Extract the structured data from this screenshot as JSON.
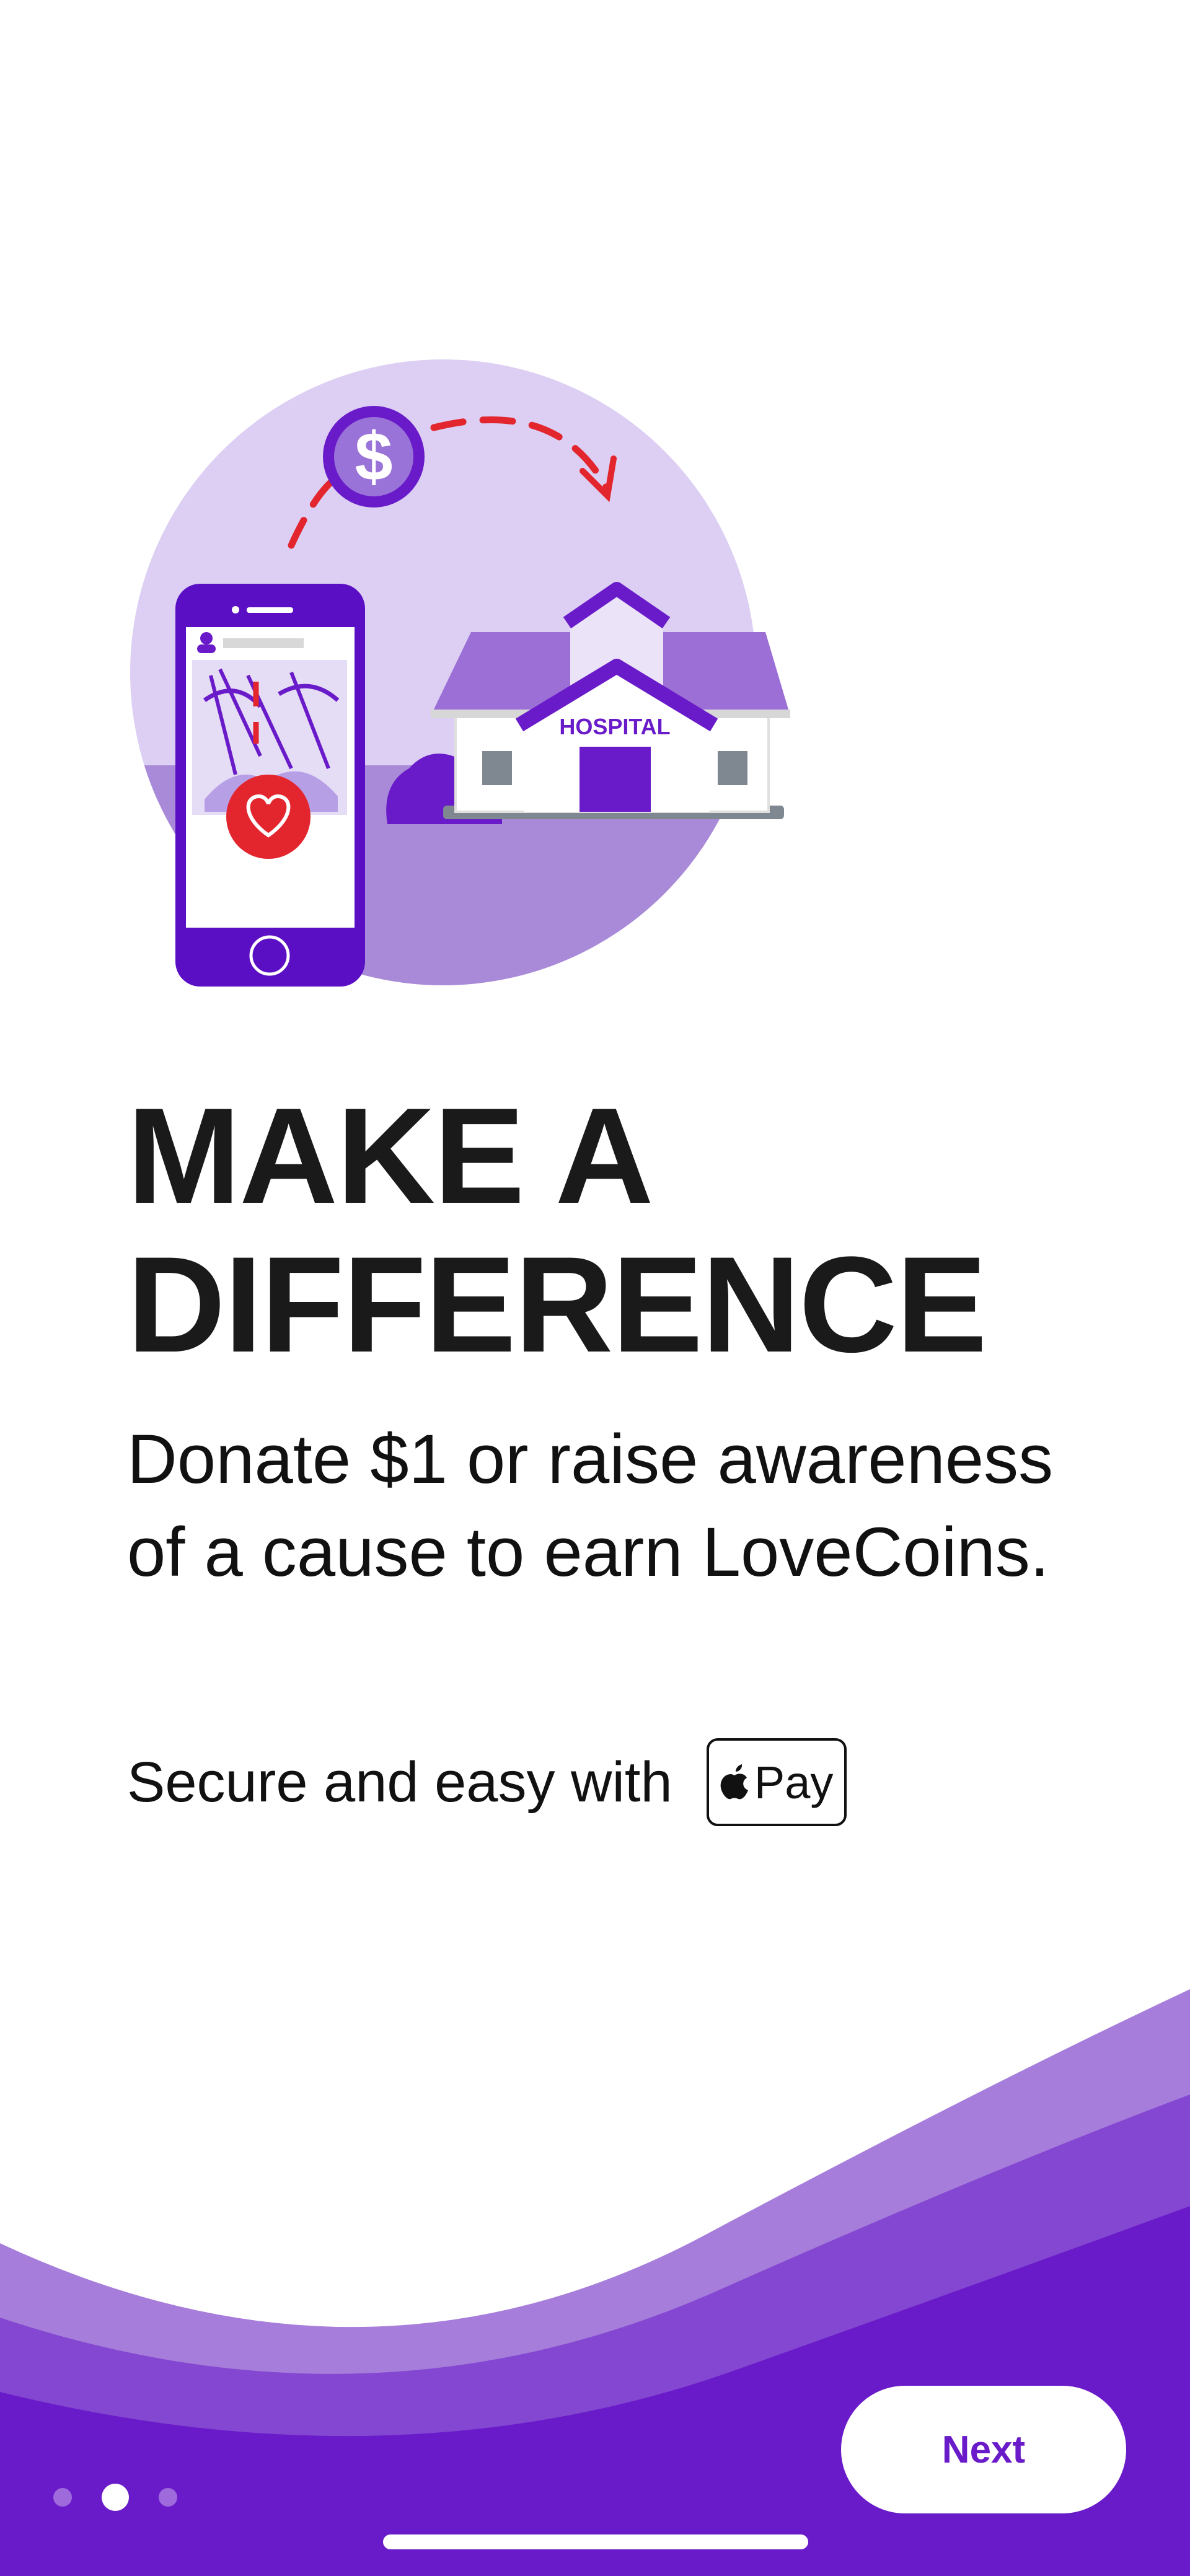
{
  "illustration": {
    "building_sign": "HOSPITAL",
    "coin_symbol": "$"
  },
  "headline": {
    "line1": "MAKE A",
    "line2": "DIFFERENCE"
  },
  "subtitle": "Donate $1 or raise awareness of a cause to earn LoveCoins.",
  "payment": {
    "label": "Secure and easy with",
    "badge_text": "Pay",
    "badge_icon": "apple-logo-icon"
  },
  "next_button": {
    "label": "Next"
  },
  "pager": {
    "count": 3,
    "active_index": 1
  },
  "colors": {
    "brand_purple": "#6a1bc9",
    "light_purple": "#dccff3",
    "mid_purple": "#9b6fd6",
    "heart_red": "#e3262e"
  }
}
